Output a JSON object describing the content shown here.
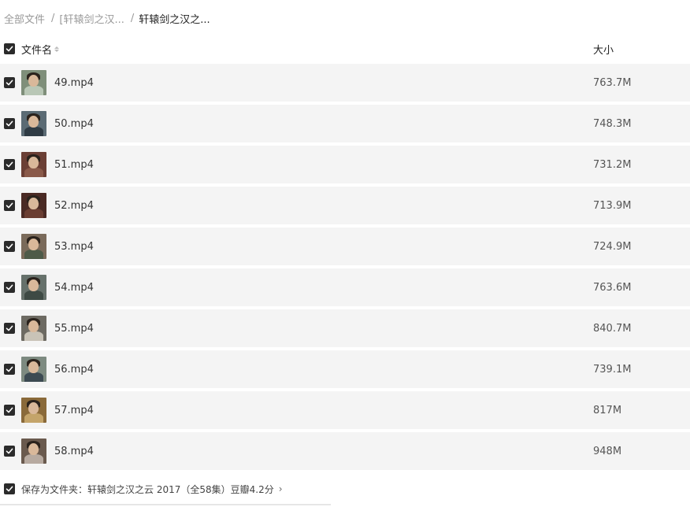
{
  "breadcrumb": {
    "root": "全部文件",
    "parent": "[轩辕剑之汉...",
    "current": "轩辕剑之汉之...",
    "separator": "/"
  },
  "header": {
    "name_col": "文件名",
    "size_col": "大小"
  },
  "files": [
    {
      "name": "49.mp4",
      "size": "763.7M",
      "thumb_bg": "#7f8f7a",
      "thumb_body": "#b9c7b6"
    },
    {
      "name": "50.mp4",
      "size": "748.3M",
      "thumb_bg": "#5b6b74",
      "thumb_body": "#2f3b44"
    },
    {
      "name": "51.mp4",
      "size": "731.2M",
      "thumb_bg": "#6b3f35",
      "thumb_body": "#8a5a4a"
    },
    {
      "name": "52.mp4",
      "size": "713.9M",
      "thumb_bg": "#4a2a24",
      "thumb_body": "#6a3e32"
    },
    {
      "name": "53.mp4",
      "size": "724.9M",
      "thumb_bg": "#7a6a5a",
      "thumb_body": "#4e5a48"
    },
    {
      "name": "54.mp4",
      "size": "763.6M",
      "thumb_bg": "#66716b",
      "thumb_body": "#3e4a44"
    },
    {
      "name": "55.mp4",
      "size": "840.7M",
      "thumb_bg": "#6d6a62",
      "thumb_body": "#c9c3b7"
    },
    {
      "name": "56.mp4",
      "size": "739.1M",
      "thumb_bg": "#7d8a80",
      "thumb_body": "#3c4a52"
    },
    {
      "name": "57.mp4",
      "size": "817M",
      "thumb_bg": "#8a6a3a",
      "thumb_body": "#c4a46a"
    },
    {
      "name": "58.mp4",
      "size": "948M",
      "thumb_bg": "#6a5a4e",
      "thumb_body": "#b7aaa0"
    }
  ],
  "footer": {
    "save_label": "保存为文件夹：轩辕剑之汉之云 2017（全58集）豆瓣4.2分",
    "chevron": "›"
  },
  "icons": {
    "checkbox": "checkbox-checked-icon",
    "sort": "sort-icon",
    "chevron": "chevron-right-icon"
  },
  "colors": {
    "checkbox": "#2b2b2b",
    "row_bg": "#f4f4f4"
  }
}
